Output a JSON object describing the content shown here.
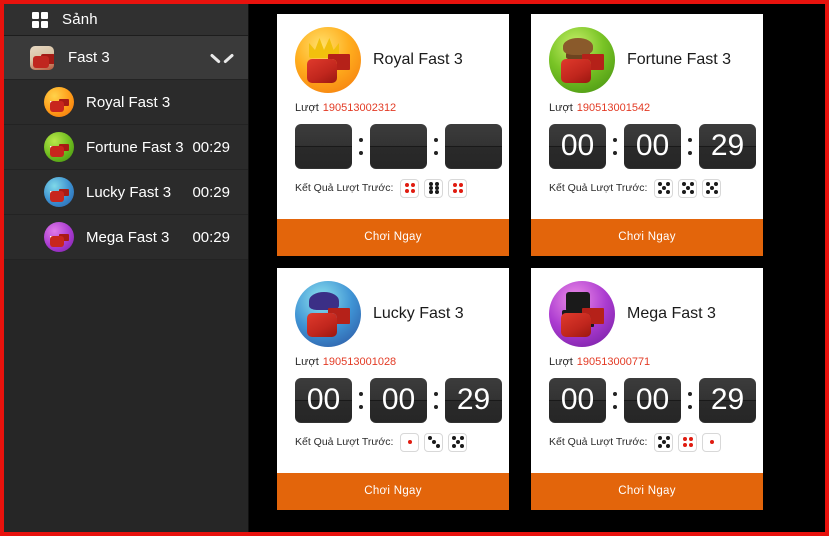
{
  "theme": {
    "accent_orange": "#e3650b",
    "border_red": "#e8120d",
    "round_number_red": "#e33b25",
    "sidebar_bg": "#262626",
    "page_bg": "#000000"
  },
  "sidebar": {
    "lobby": {
      "label": "Sảnh",
      "icon": "grid-icon"
    },
    "group": {
      "label": "Fast 3",
      "icon": "dice-thumb-icon",
      "chevron": "chevron-down-icon",
      "expanded": true
    },
    "items": [
      {
        "label": "Royal Fast 3",
        "time": "",
        "avatar": "royal-avatar-icon"
      },
      {
        "label": "Fortune Fast 3",
        "time": "00:29",
        "avatar": "fortune-avatar-icon"
      },
      {
        "label": "Lucky Fast 3",
        "time": "00:29",
        "avatar": "lucky-avatar-icon"
      },
      {
        "label": "Mega Fast 3",
        "time": "00:29",
        "avatar": "mega-avatar-icon"
      }
    ]
  },
  "labels": {
    "round_prefix": "Lượt",
    "prev_result": "Kết Quả Lượt Trước:",
    "play_now": "Chơi Ngay"
  },
  "cards": [
    {
      "title": "Royal Fast 3",
      "round": "190513002312",
      "logo": "royal-logo-icon",
      "timer": {
        "h": "",
        "m": "",
        "s": "",
        "blank": true
      },
      "prev_dice": [
        {
          "value": 4,
          "color": "red"
        },
        {
          "value": 6,
          "color": "black"
        },
        {
          "value": 4,
          "color": "red"
        }
      ],
      "play_label": "Chơi Ngay"
    },
    {
      "title": "Fortune Fast 3",
      "round": "190513001542",
      "logo": "fortune-logo-icon",
      "timer": {
        "h": "00",
        "m": "00",
        "s": "29",
        "blank": false
      },
      "prev_dice": [
        {
          "value": 5,
          "color": "black"
        },
        {
          "value": 5,
          "color": "black"
        },
        {
          "value": 5,
          "color": "black"
        }
      ],
      "play_label": "Chơi Ngay"
    },
    {
      "title": "Lucky Fast 3",
      "round": "190513001028",
      "logo": "lucky-logo-icon",
      "timer": {
        "h": "00",
        "m": "00",
        "s": "29",
        "blank": false
      },
      "prev_dice": [
        {
          "value": 1,
          "color": "red"
        },
        {
          "value": 3,
          "color": "black"
        },
        {
          "value": 5,
          "color": "black"
        }
      ],
      "play_label": "Chơi Ngay"
    },
    {
      "title": "Mega Fast 3",
      "round": "190513000771",
      "logo": "mega-logo-icon",
      "timer": {
        "h": "00",
        "m": "00",
        "s": "29",
        "blank": false
      },
      "prev_dice": [
        {
          "value": 5,
          "color": "black"
        },
        {
          "value": 4,
          "color": "red"
        },
        {
          "value": 1,
          "color": "red"
        }
      ],
      "play_label": "Chơi Ngay"
    }
  ]
}
